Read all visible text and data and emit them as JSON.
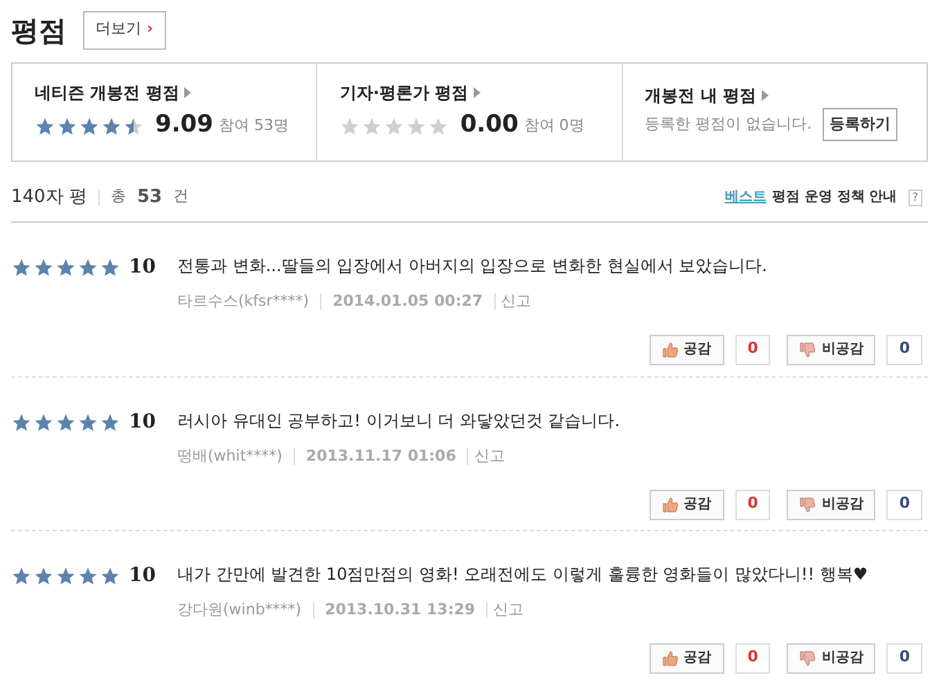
{
  "header": {
    "title": "평점",
    "more_button": "더보기",
    "more_arrow": "›"
  },
  "summary": [
    {
      "kind": "score",
      "title": "네티즌 개봉전 평점",
      "stars": 4.5,
      "score": "9.09",
      "participants": "참여 53명"
    },
    {
      "kind": "score",
      "title": "기자·평론가 평점",
      "stars": 0,
      "score": "0.00",
      "participants": "참여 0명"
    },
    {
      "kind": "mine",
      "title": "개봉전 내 평점",
      "message": "등록한 평점이 없습니다.",
      "button": "등록하기"
    }
  ],
  "list_header": {
    "title": "140자 평",
    "total_label": "총",
    "total": "53",
    "unit": "건",
    "best": "베스트",
    "policy": "평점 운영 정책 안내",
    "help": "?"
  },
  "reviews": [
    {
      "stars": 5,
      "score": "10",
      "text": "전통과 변화...딸들의 입장에서 아버지의 입장으로 변화한 현실에서 보았습니다.",
      "author": "타르수스(kfsr****)",
      "date": "2014.01.05 00:27",
      "report": "신고",
      "like_label": "공감",
      "likes": "0",
      "dislike_label": "비공감",
      "dislikes": "0"
    },
    {
      "stars": 5,
      "score": "10",
      "text": "러시아 유대인 공부하고! 이거보니 더 와닿았던것 같습니다.",
      "author": "떵배(whit****)",
      "date": "2013.11.17 01:06",
      "report": "신고",
      "like_label": "공감",
      "likes": "0",
      "dislike_label": "비공감",
      "dislikes": "0"
    },
    {
      "stars": 5,
      "score": "10",
      "text": "내가 간만에 발견한 10점만점의 영화! 오래전에도 이렇게 훌륭한 영화들이 많았다니!! 행복♥",
      "author": "강다원(winb****)",
      "date": "2013.10.31 13:29",
      "report": "신고",
      "like_label": "공감",
      "likes": "0",
      "dislike_label": "비공감",
      "dislikes": "0"
    }
  ]
}
